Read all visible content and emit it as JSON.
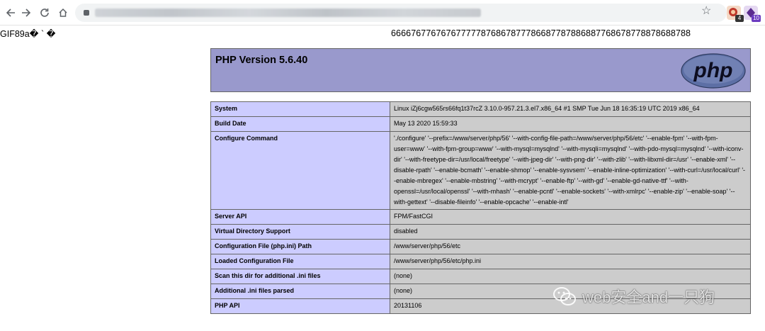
{
  "browser": {
    "icons": [
      "back-arrow-icon",
      "forward-arrow-icon",
      "reload-icon",
      "home-icon",
      "lock-icon",
      "star-icon"
    ],
    "extensions": [
      {
        "name": "extension-1-icon",
        "badge": "4",
        "color": "#c0392b"
      },
      {
        "name": "extension-2-icon",
        "badge": "10",
        "color": "#5b2c8f"
      }
    ]
  },
  "page": {
    "gif_header": "GIF89a\u0000\u0000\u0000 ` \u0000",
    "gif_header_display": "GIF89a� ` �",
    "digits": "666676776767677777876867877786687787886887768678778878688788"
  },
  "phpinfo": {
    "title": "PHP Version 5.6.40",
    "logo_text": "php",
    "header_color": "#9999cc",
    "label_color": "#ccccff",
    "value_color": "#cccccc",
    "rows": [
      {
        "label": "System",
        "value": "Linux iZj6cgw565rs66fq1t37rcZ 3.10.0-957.21.3.el7.x86_64 #1 SMP Tue Jun 18 16:35:19 UTC 2019 x86_64"
      },
      {
        "label": "Build Date",
        "value": "May 13 2020 15:59:33"
      },
      {
        "label": "Configure Command",
        "value": "'./configure' '--prefix=/www/server/php/56' '--with-config-file-path=/www/server/php/56/etc' '--enable-fpm' '--with-fpm-user=www' '--with-fpm-group=www' '--with-mysql=mysqlnd' '--with-mysqli=mysqlnd' '--with-pdo-mysql=mysqlnd' '--with-iconv-dir' '--with-freetype-dir=/usr/local/freetype' '--with-jpeg-dir' '--with-png-dir' '--with-zlib' '--with-libxml-dir=/usr' '--enable-xml' '--disable-rpath' '--enable-bcmath' '--enable-shmop' '--enable-sysvsem' '--enable-inline-optimization' '--with-curl=/usr/local/curl' '--enable-mbregex' '--enable-mbstring' '--with-mcrypt' '--enable-ftp' '--with-gd' '--enable-gd-native-ttf' '--with-openssl=/usr/local/openssl' '--with-mhash' '--enable-pcntl' '--enable-sockets' '--with-xmlrpc' '--enable-zip' '--enable-soap' '--with-gettext' '--disable-fileinfo' '--enable-opcache' '--enable-intl'"
      },
      {
        "label": "Server API",
        "value": "FPM/FastCGI"
      },
      {
        "label": "Virtual Directory Support",
        "value": "disabled"
      },
      {
        "label": "Configuration File (php.ini) Path",
        "value": "/www/server/php/56/etc"
      },
      {
        "label": "Loaded Configuration File",
        "value": "/www/server/php/56/etc/php.ini"
      },
      {
        "label": "Scan this dir for additional .ini files",
        "value": "(none)"
      },
      {
        "label": "Additional .ini files parsed",
        "value": "(none)"
      },
      {
        "label": "PHP API",
        "value": "20131106"
      }
    ]
  },
  "watermark": {
    "text": "web安全and一只狗",
    "icon": "wechat-icon"
  }
}
